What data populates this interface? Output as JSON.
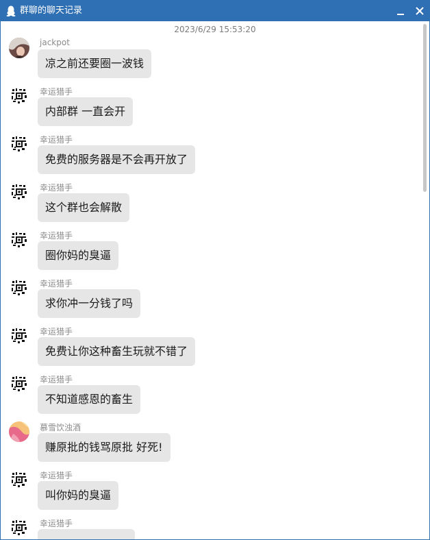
{
  "window": {
    "title": "群聊的聊天记录",
    "title_icon": "qq-penguin-icon",
    "accent_color": "#2f6fb3",
    "bubble_color": "#e6e6e6"
  },
  "timestamp": "2023/6/29 15:53:20",
  "messages": [
    {
      "sender": "jackpot",
      "text": "凉之前还要圈一波钱",
      "avatar": "character-avatar"
    },
    {
      "sender": "幸运猎手",
      "text": "内部群 一直会开",
      "avatar": "qr-avatar"
    },
    {
      "sender": "幸运猎手",
      "text": "免费的服务器是不会再开放了",
      "avatar": "qr-avatar"
    },
    {
      "sender": "幸运猎手",
      "text": "这个群也会解散",
      "avatar": "qr-avatar"
    },
    {
      "sender": "幸运猎手",
      "text": "圈你妈的臭逼",
      "avatar": "qr-avatar"
    },
    {
      "sender": "幸运猎手",
      "text": "求你冲一分钱了吗",
      "avatar": "qr-avatar"
    },
    {
      "sender": "幸运猎手",
      "text": "免费让你这种畜生玩就不错了",
      "avatar": "qr-avatar"
    },
    {
      "sender": "幸运猎手",
      "text": "不知道感恩的畜生",
      "avatar": "qr-avatar"
    },
    {
      "sender": "慕雪饮浊酒",
      "text": "赚原批的钱骂原批 好死!",
      "avatar": "pink-avatar"
    },
    {
      "sender": "幸运猎手",
      "text": "叫你妈的臭逼",
      "avatar": "qr-avatar"
    },
    {
      "sender": "幸运猎手",
      "text": "",
      "avatar": "qr-avatar"
    }
  ]
}
